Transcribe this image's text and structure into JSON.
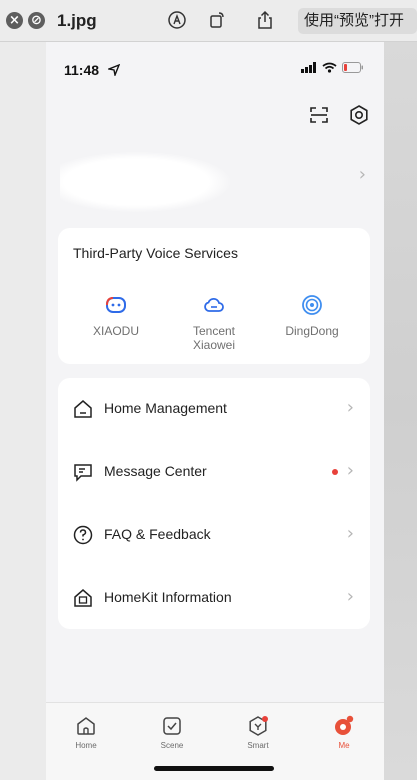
{
  "titlebar": {
    "filename": "1.jpg",
    "open_with_label": "使用“预览”打开"
  },
  "status_bar": {
    "time": "11:48"
  },
  "voice_services": {
    "title": "Third-Party Voice Services",
    "items": [
      {
        "label": "XIAODU",
        "icon": "xiaodu-icon"
      },
      {
        "label": "Tencent Xiaowei",
        "icon": "cloud-icon"
      },
      {
        "label": "DingDong",
        "icon": "dingdong-icon"
      }
    ]
  },
  "menu": {
    "items": [
      {
        "label": "Home Management",
        "icon": "house-icon",
        "badge": false
      },
      {
        "label": "Message Center",
        "icon": "message-icon",
        "badge": true
      },
      {
        "label": "FAQ & Feedback",
        "icon": "question-icon",
        "badge": false
      },
      {
        "label": "HomeKit Information",
        "icon": "homekit-icon",
        "badge": false
      }
    ]
  },
  "tabbar": {
    "tabs": [
      {
        "label": "Home",
        "active": false
      },
      {
        "label": "Scene",
        "active": false
      },
      {
        "label": "Smart",
        "active": false,
        "badge": true
      },
      {
        "label": "Me",
        "active": true
      }
    ]
  },
  "colors": {
    "accent": "#e8513a",
    "badge_red": "#e8413a",
    "xiaodu_blue": "#2f6be8",
    "dingdong_blue": "#3f8ef0"
  }
}
